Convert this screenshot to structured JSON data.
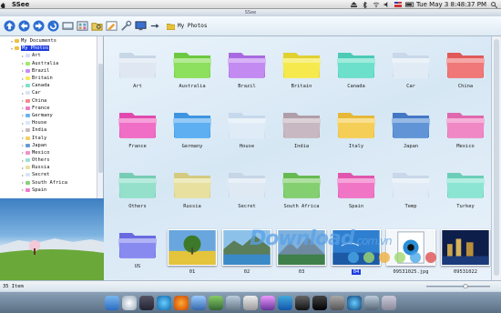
{
  "menubar": {
    "app": "SSee",
    "datetime": "Tue May 3  8:48:37 PM"
  },
  "window": {
    "title": "SSee"
  },
  "toolbar": {
    "path": "My Photos"
  },
  "tree": {
    "items": [
      {
        "label": "My Documents",
        "depth": 0,
        "color": "#f0c040"
      },
      {
        "label": "My Photos",
        "depth": 0,
        "color": "#f0c040",
        "selected": true
      },
      {
        "label": "Art",
        "depth": 1,
        "color": "#d9d9ff"
      },
      {
        "label": "Australia",
        "depth": 1,
        "color": "#9ee86a"
      },
      {
        "label": "Brazil",
        "depth": 1,
        "color": "#c78cf0"
      },
      {
        "label": "Britain",
        "depth": 1,
        "color": "#f6e85a"
      },
      {
        "label": "Canada",
        "depth": 1,
        "color": "#7fe0d0"
      },
      {
        "label": "Car",
        "depth": 1,
        "color": "#d8e6f4"
      },
      {
        "label": "China",
        "depth": 1,
        "color": "#f28a8a"
      },
      {
        "label": "France",
        "depth": 1,
        "color": "#f07ac8"
      },
      {
        "label": "Germany",
        "depth": 1,
        "color": "#68b4f0"
      },
      {
        "label": "House",
        "depth": 1,
        "color": "#d8e8f8"
      },
      {
        "label": "India",
        "depth": 1,
        "color": "#c8b8c0"
      },
      {
        "label": "Italy",
        "depth": 1,
        "color": "#f6d060"
      },
      {
        "label": "Japan",
        "depth": 1,
        "color": "#6a9ad8"
      },
      {
        "label": "Mexico",
        "depth": 1,
        "color": "#f090c8"
      },
      {
        "label": "Others",
        "depth": 1,
        "color": "#9ee0d0"
      },
      {
        "label": "Russia",
        "depth": 1,
        "color": "#e8e0a0"
      },
      {
        "label": "Secret",
        "depth": 1,
        "color": "#d8e6f4"
      },
      {
        "label": "South Africa",
        "depth": 1,
        "color": "#8ad07a"
      },
      {
        "label": "Spain",
        "depth": 1,
        "color": "#f07ac8"
      }
    ]
  },
  "grid": {
    "folders": [
      {
        "label": "Art",
        "color": "#dfe8f2",
        "tab": "#c8d6e6"
      },
      {
        "label": "Australia",
        "color": "#8fe060",
        "tab": "#6cc840"
      },
      {
        "label": "Brazil",
        "color": "#c48cf2",
        "tab": "#a86ae0"
      },
      {
        "label": "Britain",
        "color": "#f6ea50",
        "tab": "#e0d030"
      },
      {
        "label": "Canada",
        "color": "#6fe0cc",
        "tab": "#4ccab6"
      },
      {
        "label": "Car",
        "color": "#e2ecf6",
        "tab": "#c8d8ea"
      },
      {
        "label": "China",
        "color": "#f07a7a",
        "tab": "#e05a5a"
      },
      {
        "label": "France",
        "color": "#f070c6",
        "tab": "#e04aae"
      },
      {
        "label": "Germany",
        "color": "#5fb0f2",
        "tab": "#3f94e0"
      },
      {
        "label": "House",
        "color": "#e0ecf8",
        "tab": "#c6d8ec"
      },
      {
        "label": "India",
        "color": "#c9b9c2",
        "tab": "#b09ea8"
      },
      {
        "label": "Italy",
        "color": "#f6cf58",
        "tab": "#e6b838"
      },
      {
        "label": "Japan",
        "color": "#6296d8",
        "tab": "#4478c4"
      },
      {
        "label": "Mexico",
        "color": "#f08ac6",
        "tab": "#e068ae"
      },
      {
        "label": "Others",
        "color": "#96e0cc",
        "tab": "#76ccb4"
      },
      {
        "label": "Russia",
        "color": "#e8e0a0",
        "tab": "#d4ca80"
      },
      {
        "label": "Secret",
        "color": "#e0eaf4",
        "tab": "#c6d6e6"
      },
      {
        "label": "South Africa",
        "color": "#86d072",
        "tab": "#66ba52"
      },
      {
        "label": "Spain",
        "color": "#f078c6",
        "tab": "#e056ae"
      },
      {
        "label": "Temp",
        "color": "#e2ecf6",
        "tab": "#c8d8ea"
      },
      {
        "label": "Turkey",
        "color": "#8ee6d4",
        "tab": "#6ccdb8"
      },
      {
        "label": "US",
        "color": "#8a8cf0",
        "tab": "#6a6ae0"
      }
    ],
    "images": [
      {
        "label": "01",
        "kind": "tree"
      },
      {
        "label": "02",
        "kind": "lake"
      },
      {
        "label": "03",
        "kind": "mountain"
      },
      {
        "label": "04",
        "kind": "sky",
        "selected": true
      },
      {
        "label": "09531025.jpg",
        "kind": "file"
      },
      {
        "label": "09531022",
        "kind": "city"
      }
    ]
  },
  "watermark": {
    "text": "Download",
    "suffix": ".com.vn"
  },
  "status": {
    "count": "35 Item"
  }
}
